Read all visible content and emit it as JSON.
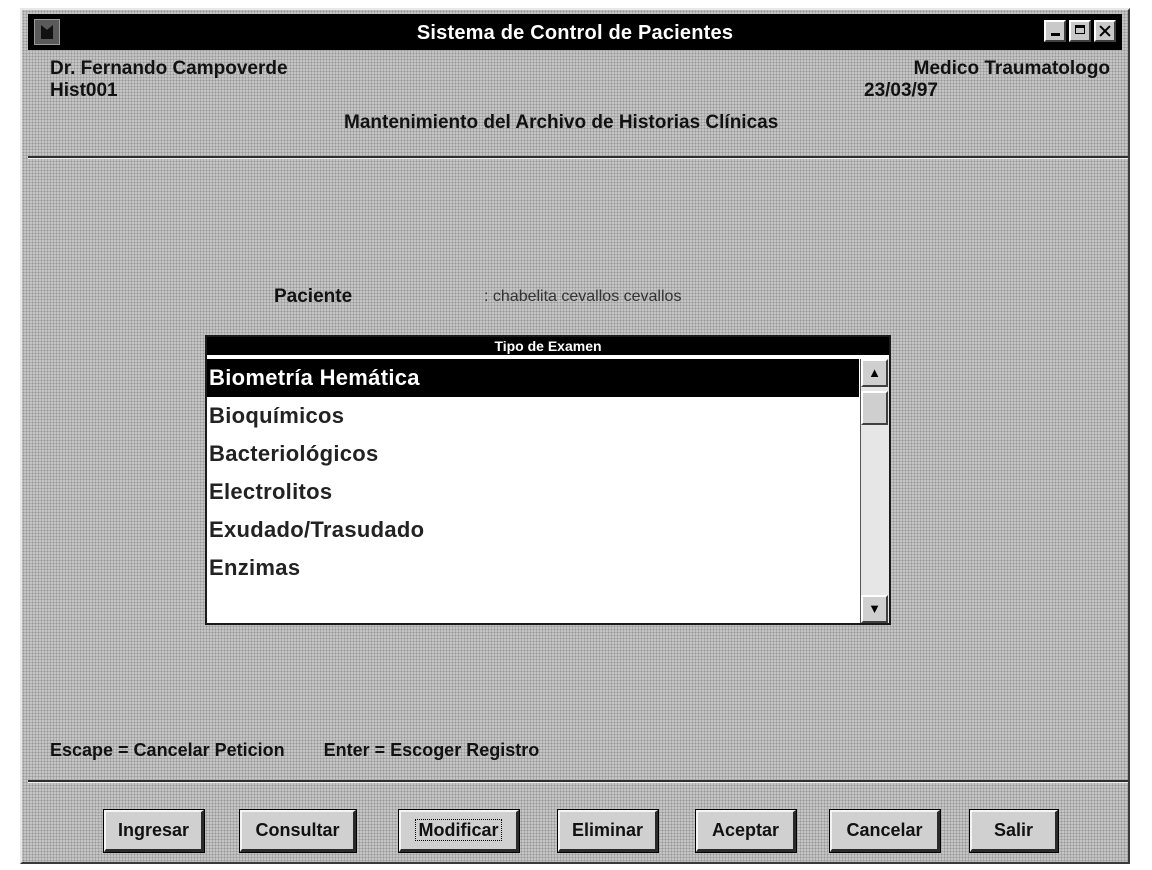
{
  "window": {
    "title": "Sistema de Control de Pacientes"
  },
  "header": {
    "doctor_name": "Dr. Fernando Campoverde",
    "doctor_specialty": "Medico Traumatologo",
    "screen_code": "Hist001",
    "date": "23/03/97",
    "subtitle": "Mantenimiento del Archivo de Historias Clínicas"
  },
  "patient": {
    "label": "Paciente",
    "value": ": chabelita cevallos cevallos"
  },
  "exam_list": {
    "header": "Tipo de Examen",
    "selected_index": 0,
    "items": [
      "Biometría Hemática",
      "Bioquímicos",
      "Bacteriológicos",
      "Electrolitos",
      "Exudado/Trasudado",
      "Enzimas"
    ]
  },
  "hints": {
    "escape": "Escape = Cancelar Peticion",
    "enter": "Enter = Escoger Registro"
  },
  "buttons": {
    "ingresar": "Ingresar",
    "consultar": "Consultar",
    "modificar": "Modificar",
    "eliminar": "Eliminar",
    "aceptar": "Aceptar",
    "cancelar": "Cancelar",
    "salir": "Salir"
  },
  "colors": {
    "window_bg": "#c4c4c4",
    "title_bar": "#000000",
    "selected_row": "#000000"
  }
}
